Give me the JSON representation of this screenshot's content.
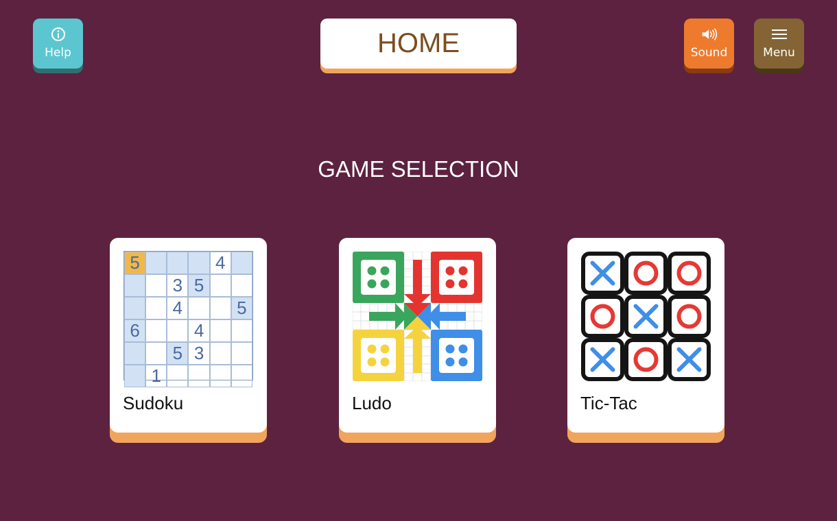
{
  "header": {
    "title": "HOME",
    "help_label": "Help",
    "sound_label": "Sound",
    "menu_label": "Menu"
  },
  "section_title": "GAME SELECTION",
  "games": [
    {
      "id": "sudoku",
      "label": "Sudoku"
    },
    {
      "id": "ludo",
      "label": "Ludo"
    },
    {
      "id": "tictac",
      "label": "Tic-Tac"
    }
  ],
  "sudoku_preview": {
    "cells": [
      [
        "5",
        "",
        "",
        "",
        "4",
        ""
      ],
      [
        "",
        "",
        "3",
        "5",
        "",
        ""
      ],
      [
        "",
        "",
        "4",
        "",
        "",
        "5"
      ],
      [
        "6",
        "",
        "",
        "4",
        "",
        ""
      ],
      [
        "",
        "",
        "5",
        "3",
        "",
        ""
      ],
      [
        "",
        "1",
        "",
        "",
        "",
        ""
      ]
    ],
    "selected": [
      0,
      0
    ],
    "highlighted": [
      [
        0,
        1
      ],
      [
        0,
        2
      ],
      [
        0,
        3
      ],
      [
        0,
        5
      ],
      [
        1,
        0
      ],
      [
        1,
        3
      ],
      [
        2,
        0
      ],
      [
        2,
        5
      ],
      [
        3,
        0
      ],
      [
        4,
        0
      ],
      [
        4,
        2
      ],
      [
        5,
        0
      ]
    ]
  },
  "tictac_preview": {
    "board": [
      [
        "X",
        "O",
        "O"
      ],
      [
        "O",
        "X",
        "O"
      ],
      [
        "X",
        "O",
        "X"
      ]
    ]
  },
  "colors": {
    "background": "#5c2240",
    "accent_orange": "#f1a55c",
    "title_text": "#7a4e20",
    "help": "#5cc6d0",
    "sound": "#ee7b2d",
    "menu": "#846434",
    "x_blue": "#3f8ee8",
    "o_red": "#e53935"
  },
  "icons": {
    "help": "info-icon",
    "sound": "speaker-icon",
    "menu": "hamburger-icon"
  }
}
